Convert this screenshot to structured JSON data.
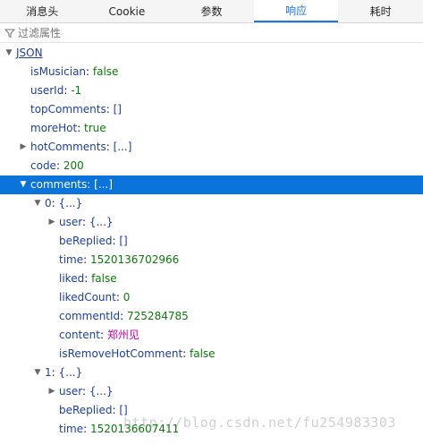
{
  "tabs": [
    {
      "label": "消息头"
    },
    {
      "label": "Cookie"
    },
    {
      "label": "参数"
    },
    {
      "label": "响应"
    },
    {
      "label": "耗时"
    }
  ],
  "filter": {
    "placeholder": "过滤属性",
    "icon": "filter-icon"
  },
  "tree": {
    "root": {
      "label": "JSON"
    },
    "rows": [
      {
        "key": "isMusician",
        "value": "false"
      },
      {
        "key": "userId",
        "value": "-1"
      },
      {
        "key": "topComments",
        "value": "[]"
      },
      {
        "key": "moreHot",
        "value": "true"
      },
      {
        "key": "hotComments",
        "value": "[...]"
      },
      {
        "key": "code",
        "value": "200"
      },
      {
        "key": "comments",
        "value": "[...]"
      },
      {
        "key": "0",
        "value": "{...}"
      },
      {
        "key": "user",
        "value": "{...}"
      },
      {
        "key": "beReplied",
        "value": "[]"
      },
      {
        "key": "time",
        "value": "1520136702966"
      },
      {
        "key": "liked",
        "value": "false"
      },
      {
        "key": "likedCount",
        "value": "0"
      },
      {
        "key": "commentId",
        "value": "725284785"
      },
      {
        "key": "content",
        "value": "郑州见"
      },
      {
        "key": "isRemoveHotComment",
        "value": "false"
      },
      {
        "key": "1",
        "value": "{...}"
      },
      {
        "key": "user",
        "value": "{...}"
      },
      {
        "key": "beReplied",
        "value": "[]"
      },
      {
        "key": "time",
        "value": "1520136607411"
      }
    ]
  },
  "watermark": "http://blog.csdn.net/fu254983303"
}
